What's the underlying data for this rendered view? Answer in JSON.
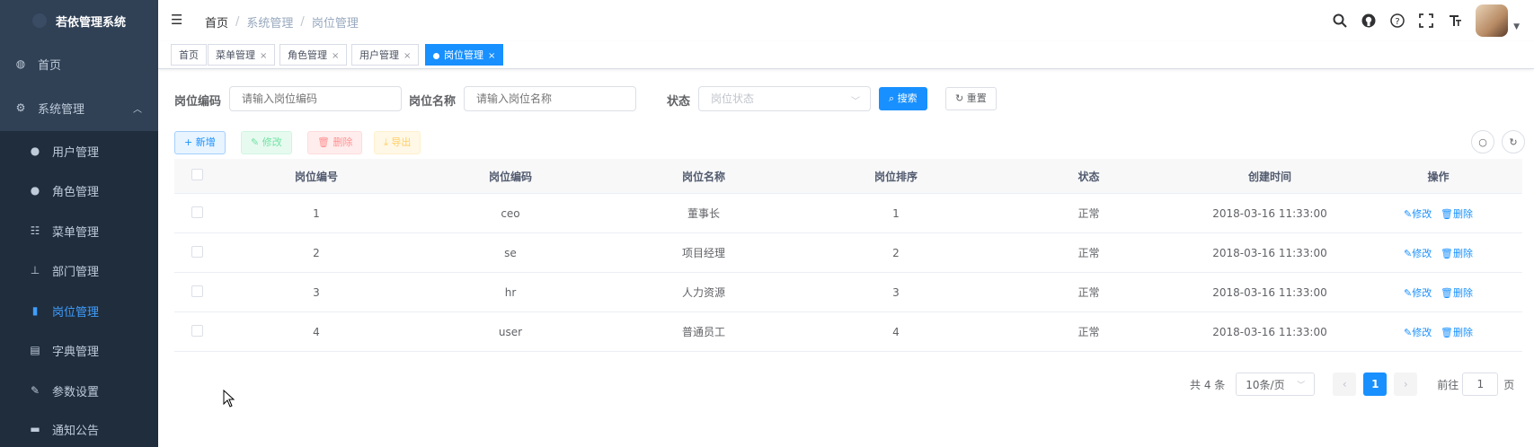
{
  "sidebar": {
    "title": "若依管理系统",
    "items": [
      {
        "label": "首页",
        "icon": "dashboard-icon",
        "glyph": "◍"
      },
      {
        "label": "系统管理",
        "icon": "system-icon",
        "glyph": "⚙"
      },
      {
        "label": "用户管理",
        "icon": "user-icon",
        "glyph": "👤"
      },
      {
        "label": "角色管理",
        "icon": "peoples-icon",
        "glyph": "👥"
      },
      {
        "label": "菜单管理",
        "icon": "tree-table-icon",
        "glyph": "☷"
      },
      {
        "label": "部门管理",
        "icon": "tree-icon",
        "glyph": "⊥"
      },
      {
        "label": "岗位管理",
        "icon": "post-icon",
        "glyph": "▮"
      },
      {
        "label": "字典管理",
        "icon": "dict-icon",
        "glyph": "▤"
      },
      {
        "label": "参数设置",
        "icon": "edit-icon",
        "glyph": "✎"
      },
      {
        "label": "通知公告",
        "icon": "message-icon",
        "glyph": "▬"
      }
    ]
  },
  "navbar": {
    "breadcrumb": [
      "首页",
      "系统管理",
      "岗位管理"
    ],
    "tools": [
      "search-icon",
      "github-icon",
      "question-icon",
      "fullscreen-icon",
      "font-size-icon"
    ]
  },
  "tags": [
    "首页",
    "菜单管理",
    "角色管理",
    "用户管理",
    "岗位管理"
  ],
  "search": {
    "code_label": "岗位编码",
    "code_placeholder": "请输入岗位编码",
    "name_label": "岗位名称",
    "name_placeholder": "请输入岗位名称",
    "status_label": "状态",
    "status_placeholder": "岗位状态",
    "search_btn": "搜索",
    "reset_btn": "重置"
  },
  "toolbar": {
    "add": "新增",
    "edit": "修改",
    "delete": "删除",
    "export": "导出"
  },
  "table": {
    "headers": [
      "岗位编号",
      "岗位编码",
      "岗位名称",
      "岗位排序",
      "状态",
      "创建时间",
      "操作"
    ],
    "rows": [
      {
        "id": "1",
        "code": "ceo",
        "name": "董事长",
        "sort": "1",
        "status": "正常",
        "time": "2018-03-16 11:33:00"
      },
      {
        "id": "2",
        "code": "se",
        "name": "项目经理",
        "sort": "2",
        "status": "正常",
        "time": "2018-03-16 11:33:00"
      },
      {
        "id": "3",
        "code": "hr",
        "name": "人力资源",
        "sort": "3",
        "status": "正常",
        "time": "2018-03-16 11:33:00"
      },
      {
        "id": "4",
        "code": "user",
        "name": "普通员工",
        "sort": "4",
        "status": "正常",
        "time": "2018-03-16 11:33:00"
      }
    ],
    "op_edit": "修改",
    "op_delete": "删除"
  },
  "pagination": {
    "total": "共 4 条",
    "page_size": "10条/页",
    "current": "1",
    "goto_label": "前往",
    "goto_value": "1",
    "page_unit": "页"
  },
  "colors": {
    "sidebar_bg": "#304156",
    "submenu_bg": "#1f2d3d",
    "primary": "#1890ff"
  }
}
